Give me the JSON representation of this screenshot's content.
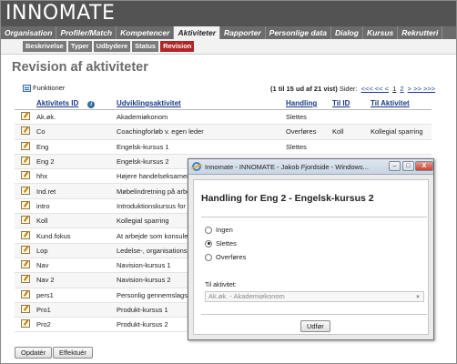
{
  "app": {
    "logo_text": "INNOMATE"
  },
  "nav": {
    "tabs": [
      {
        "label": "Organisation"
      },
      {
        "label": "Profiler/Match"
      },
      {
        "label": "Kompetencer"
      },
      {
        "label": "Aktiviteter",
        "active": true
      },
      {
        "label": "Rapporter"
      },
      {
        "label": "Personlige data"
      },
      {
        "label": "Dialog"
      },
      {
        "label": "Kursus"
      },
      {
        "label": "Rekrutteri"
      }
    ]
  },
  "subnav": {
    "tabs": [
      {
        "label": "Beskrivelse"
      },
      {
        "label": "Typer"
      },
      {
        "label": "Udbydere"
      },
      {
        "label": "Status"
      },
      {
        "label": "Revision",
        "active": true
      }
    ]
  },
  "page": {
    "title": "Revision af aktiviteter",
    "funktioner_label": "Funktioner",
    "pager_summary": "(1 til 15 ud af 21 vist)",
    "pager_label": "Sider:",
    "pager_prev": "<<< << <",
    "pager_page1": "1",
    "pager_page2": "2",
    "pager_next": "> >> >>>"
  },
  "table": {
    "columns": [
      "",
      "Aktivitets ID",
      "Udviklingsaktivitet",
      "Handling",
      "Til ID",
      "Til Aktivitet"
    ],
    "rows": [
      [
        "Ak.øk.",
        "Akademiøkonom",
        "Slettes",
        "",
        ""
      ],
      [
        "Co",
        "Coachingforløb v. egen leder",
        "Overføres",
        "Koll",
        "Kollegial sparring"
      ],
      [
        "Eng",
        "Engelsk-kursus 1",
        "Slettes",
        "",
        ""
      ],
      [
        "Eng 2",
        "Engelsk-kursus 2",
        "",
        "",
        ""
      ],
      [
        "hhx",
        "Højere handelseksamen",
        "",
        "",
        ""
      ],
      [
        "Ind.ret",
        "Møbelindretning på arbej",
        "",
        "",
        ""
      ],
      [
        "intro",
        "Introduktionskursus for n",
        "",
        "",
        ""
      ],
      [
        "Koll",
        "Kollegial sparring",
        "",
        "",
        ""
      ],
      [
        "Kund.fokus",
        "At arbejde som konsulen",
        "",
        "",
        ""
      ],
      [
        "Lop",
        "Ledelse-, organisations-",
        "",
        "",
        ""
      ],
      [
        "Nav",
        "Navision-kursus 1",
        "",
        "",
        ""
      ],
      [
        "Nav 2",
        "Navision-kursus 2",
        "",
        "",
        ""
      ],
      [
        "pers1",
        "Personlig gennemslagsk",
        "",
        "",
        ""
      ],
      [
        "Pro1",
        "Produkt-kursus 1",
        "",
        "",
        ""
      ],
      [
        "Pro2",
        "Produkt-kursus 2",
        "",
        "",
        ""
      ]
    ]
  },
  "buttons": {
    "opdater": "Opdatér",
    "effektuer": "Effektuér"
  },
  "dialog": {
    "window_title": "Innomate - INNOMATE - Jakob Fjordside - Windows...",
    "heading": "Handling for Eng 2 - Engelsk-kursus 2",
    "options": [
      {
        "label": "Ingen",
        "checked": false
      },
      {
        "label": "Slettes",
        "checked": true
      },
      {
        "label": "Overføres",
        "checked": false
      }
    ],
    "til_label": "Til aktivitet:",
    "select_value": "Ak.øk. - Akademiøkonom",
    "submit": "Udfør",
    "minimize": "–",
    "maximize": "□",
    "close": "X"
  }
}
